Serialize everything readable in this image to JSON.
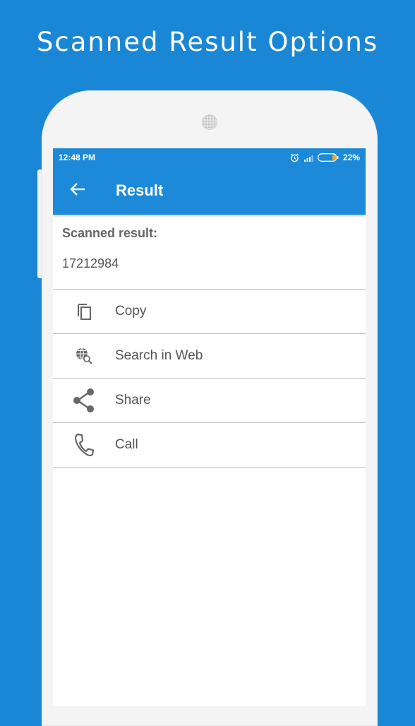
{
  "promo": {
    "title": "Scanned Result Options"
  },
  "status_bar": {
    "time": "12:48 PM",
    "battery": "22%"
  },
  "app_bar": {
    "title": "Result",
    "back_icon": "arrow-back-icon"
  },
  "result": {
    "label": "Scanned result:",
    "value": "17212984"
  },
  "actions": [
    {
      "label": "Copy",
      "icon": "copy-icon"
    },
    {
      "label": "Search in Web",
      "icon": "web-search-icon"
    },
    {
      "label": "Share",
      "icon": "share-icon"
    },
    {
      "label": "Call",
      "icon": "phone-icon"
    }
  ],
  "colors": {
    "background": "#1a87d6",
    "app_bar": "#1c8ad8",
    "battery_accent": "#f5a623"
  }
}
